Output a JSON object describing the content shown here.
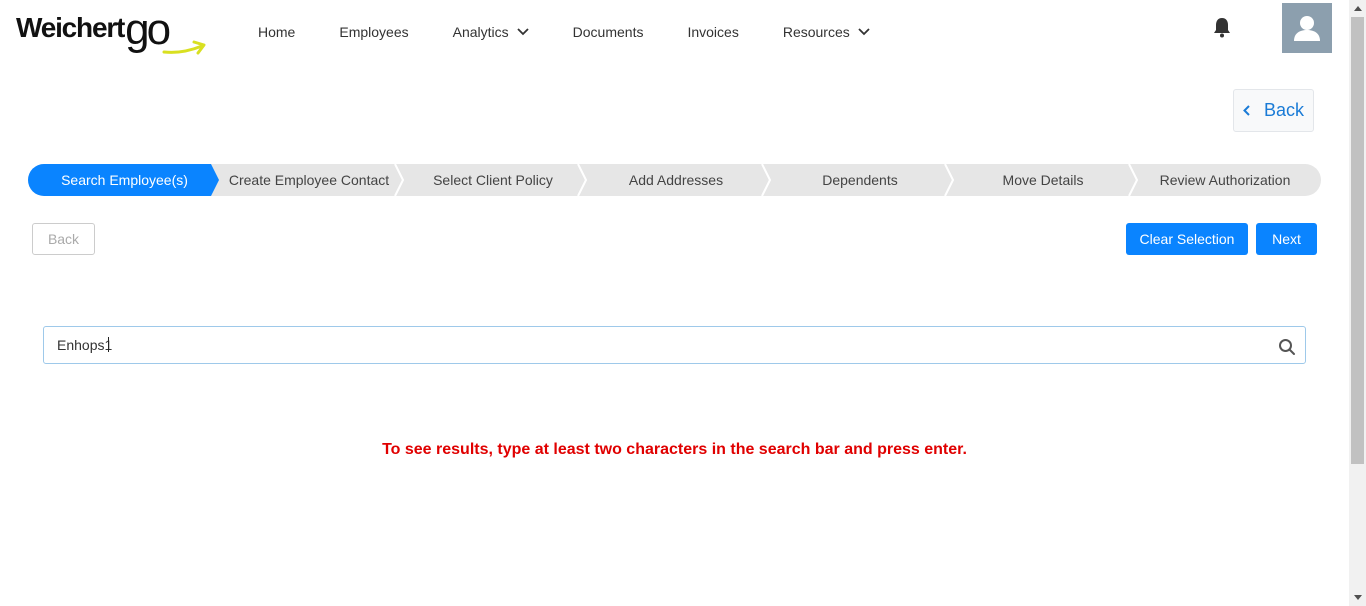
{
  "brand": {
    "word": "Weichert",
    "go": "go"
  },
  "nav": {
    "items": [
      {
        "label": "Home",
        "has_dropdown": false
      },
      {
        "label": "Employees",
        "has_dropdown": false
      },
      {
        "label": "Analytics",
        "has_dropdown": true
      },
      {
        "label": "Documents",
        "has_dropdown": false
      },
      {
        "label": "Invoices",
        "has_dropdown": false
      },
      {
        "label": "Resources",
        "has_dropdown": true
      }
    ]
  },
  "header_icons": {
    "notifications": "bell-icon",
    "profile": "user-avatar-icon"
  },
  "page": {
    "back_label": "Back"
  },
  "stepper": {
    "steps": [
      {
        "label": "Search Employee(s)",
        "active": true
      },
      {
        "label": "Create Employee Contact",
        "active": false
      },
      {
        "label": "Select Client Policy",
        "active": false
      },
      {
        "label": "Add Addresses",
        "active": false
      },
      {
        "label": "Dependents",
        "active": false
      },
      {
        "label": "Move Details",
        "active": false
      },
      {
        "label": "Review Authorization",
        "active": false
      }
    ]
  },
  "actions": {
    "back_label": "Back",
    "clear_label": "Clear Selection",
    "next_label": "Next"
  },
  "search": {
    "value": "Enhops1",
    "placeholder": ""
  },
  "hint": "To see results, type at least two characters in the search bar and press enter.",
  "colors": {
    "primary": "#0a84ff",
    "active_step": "#0a84ff",
    "step_bg": "#e6e6e6",
    "hint": "#e00000",
    "link": "#1a7bd6"
  }
}
